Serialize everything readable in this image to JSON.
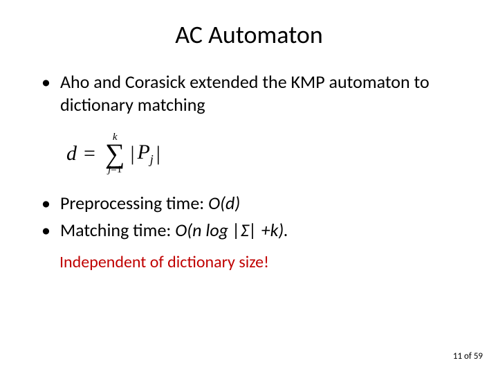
{
  "title": "AC Automaton",
  "bullets": {
    "b1": "Aho and Corasick extended the KMP automaton to dictionary matching",
    "b2_prefix": "Preprocessing time: ",
    "b2_italic": "O(d)",
    "b3_prefix": "Matching time: ",
    "b3_italic": "O(n log |Σ| +k)."
  },
  "formula": {
    "lhs": "d",
    "eq": "=",
    "sigma": "∑",
    "top": "k",
    "bot_j": "j",
    "bot_eq": "=",
    "bot_one": "1",
    "bar": "|",
    "P": "P",
    "sub": "j"
  },
  "note": "Independent  of dictionary size!",
  "footer": {
    "page": "11",
    "of": " of ",
    "total": "59"
  }
}
